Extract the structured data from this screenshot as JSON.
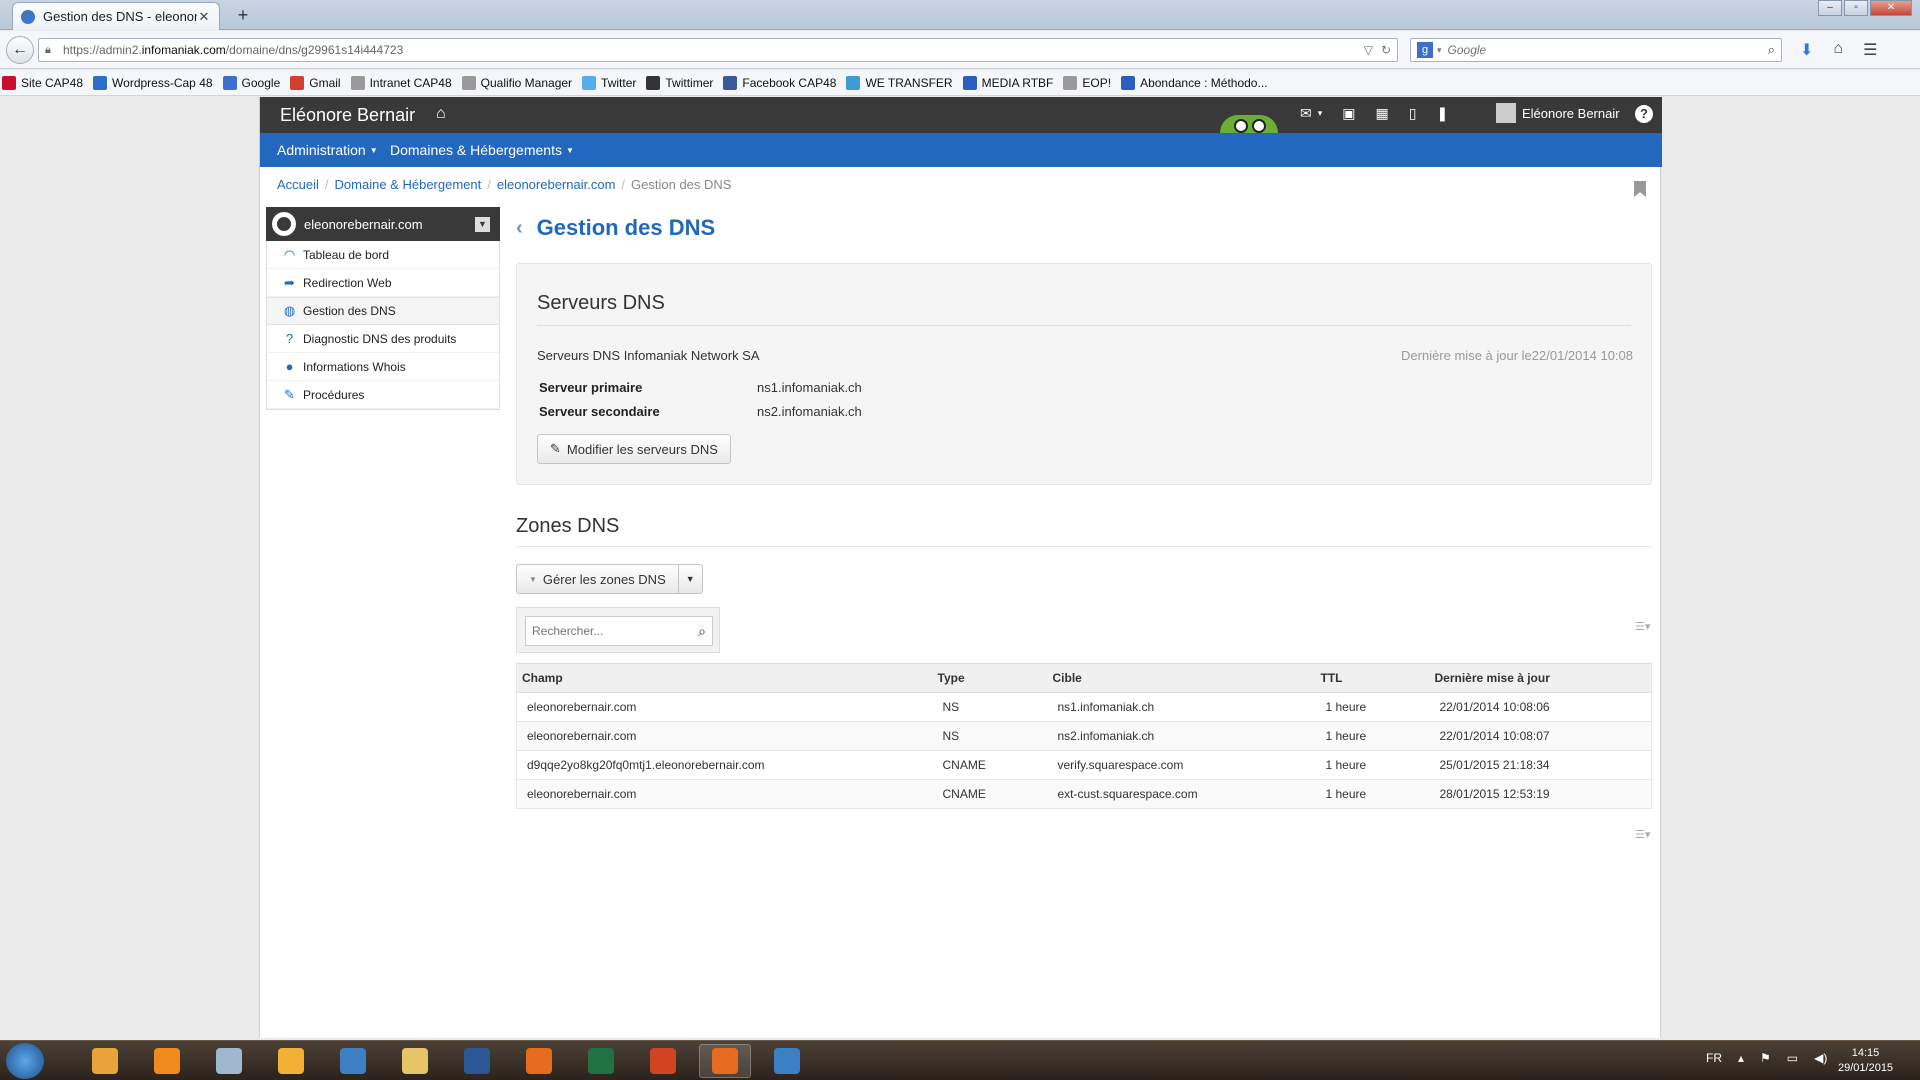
{
  "browser": {
    "tab_title": "Gestion des DNS - eleonor...",
    "tab_close": "✕",
    "new_tab": "+",
    "url_prefix": "https://admin2.",
    "url_host": "infomaniak.com",
    "url_path": "/domaine/dns/g29961s14i444723",
    "search_placeholder": "Google",
    "bookmarks": [
      {
        "label": "Site CAP48",
        "color": "#c8102e"
      },
      {
        "label": "Wordpress-Cap 48",
        "color": "#2a6fc9"
      },
      {
        "label": "Google",
        "color": "#3d6fcf"
      },
      {
        "label": "Gmail",
        "color": "#d23f31"
      },
      {
        "label": "Intranet CAP48",
        "color": "#9a9a9a"
      },
      {
        "label": "Qualifio Manager",
        "color": "#9a9a9a"
      },
      {
        "label": "Twitter",
        "color": "#55acee"
      },
      {
        "label": "Twittimer",
        "color": "#333333"
      },
      {
        "label": "Facebook CAP48",
        "color": "#3b5998"
      },
      {
        "label": "WE TRANSFER",
        "color": "#3c9ad6"
      },
      {
        "label": "MEDIA RTBF",
        "color": "#2a5fbf"
      },
      {
        "label": "EOP!",
        "color": "#9a9a9a"
      },
      {
        "label": "Abondance : Méthodo...",
        "color": "#2a5fbf"
      }
    ]
  },
  "app": {
    "brand": "Eléonore Bernair",
    "user_name": "Eléonore Bernair",
    "help": "?",
    "menu": {
      "administration": "Administration",
      "domaines": "Domaines & Hébergements"
    },
    "breadcrumb": {
      "home": "Accueil",
      "domain_hosting": "Domaine & Hébergement",
      "domain": "eleonorebernair.com",
      "current": "Gestion des DNS",
      "sep": "/"
    },
    "sidebar": {
      "domain": "eleonorebernair.com",
      "items": [
        {
          "label": "Tableau de bord",
          "icon": "gauge-icon"
        },
        {
          "label": "Redirection Web",
          "icon": "redirect-arrow-icon"
        },
        {
          "label": "Gestion des DNS",
          "icon": "globe-icon"
        },
        {
          "label": "Diagnostic DNS des produits",
          "icon": "question-icon"
        },
        {
          "label": "Informations Whois",
          "icon": "user-icon"
        },
        {
          "label": "Procédures",
          "icon": "pencil-icon"
        }
      ]
    },
    "page_title": "Gestion des DNS",
    "servers": {
      "heading": "Serveurs DNS",
      "provider": "Serveurs DNS Infomaniak Network SA",
      "last_update": "Dernière mise à jour le22/01/2014 10:08",
      "primary_label": "Serveur primaire",
      "primary_value": "ns1.infomaniak.ch",
      "secondary_label": "Serveur secondaire",
      "secondary_value": "ns2.infomaniak.ch",
      "modify_button": "Modifier les serveurs DNS"
    },
    "zones": {
      "heading": "Zones DNS",
      "manage_button": "Gérer les zones DNS",
      "search_placeholder": "Rechercher...",
      "columns": {
        "champ": "Champ",
        "type": "Type",
        "cible": "Cible",
        "ttl": "TTL",
        "updated": "Dernière mise à jour"
      },
      "rows": [
        {
          "champ": "eleonorebernair.com",
          "type": "NS",
          "cible": "ns1.infomaniak.ch",
          "ttl": "1 heure",
          "updated": "22/01/2014 10:08:06"
        },
        {
          "champ": "eleonorebernair.com",
          "type": "NS",
          "cible": "ns2.infomaniak.ch",
          "ttl": "1 heure",
          "updated": "22/01/2014 10:08:07"
        },
        {
          "champ": "d9qqe2yo8kg20fq0mtj1.eleonorebernair.com",
          "type": "CNAME",
          "cible": "verify.squarespace.com",
          "ttl": "1 heure",
          "updated": "25/01/2015 21:18:34"
        },
        {
          "champ": "eleonorebernair.com",
          "type": "CNAME",
          "cible": "ext-cust.squarespace.com",
          "ttl": "1 heure",
          "updated": "28/01/2015 12:53:19"
        }
      ]
    }
  },
  "taskbar": {
    "lang": "FR",
    "time": "14:15",
    "date": "29/01/2015",
    "apps": [
      {
        "name": "media-player-icon",
        "color": "#e8a33a"
      },
      {
        "name": "vlc-icon",
        "color": "#f08a1d"
      },
      {
        "name": "calculator-icon",
        "color": "#9fb8cf"
      },
      {
        "name": "outlook-icon",
        "color": "#f2b134"
      },
      {
        "name": "camera-icon",
        "color": "#3d7fc4"
      },
      {
        "name": "file-explorer-icon",
        "color": "#e6c569"
      },
      {
        "name": "word-icon",
        "color": "#2b5797"
      },
      {
        "name": "firefox-icon",
        "color": "#e66b1e"
      },
      {
        "name": "excel-icon",
        "color": "#207245"
      },
      {
        "name": "powerpoint-icon",
        "color": "#d04423"
      },
      {
        "name": "firefox-icon",
        "color": "#e66b1e"
      },
      {
        "name": "camera-icon",
        "color": "#3d7fc4"
      }
    ]
  }
}
